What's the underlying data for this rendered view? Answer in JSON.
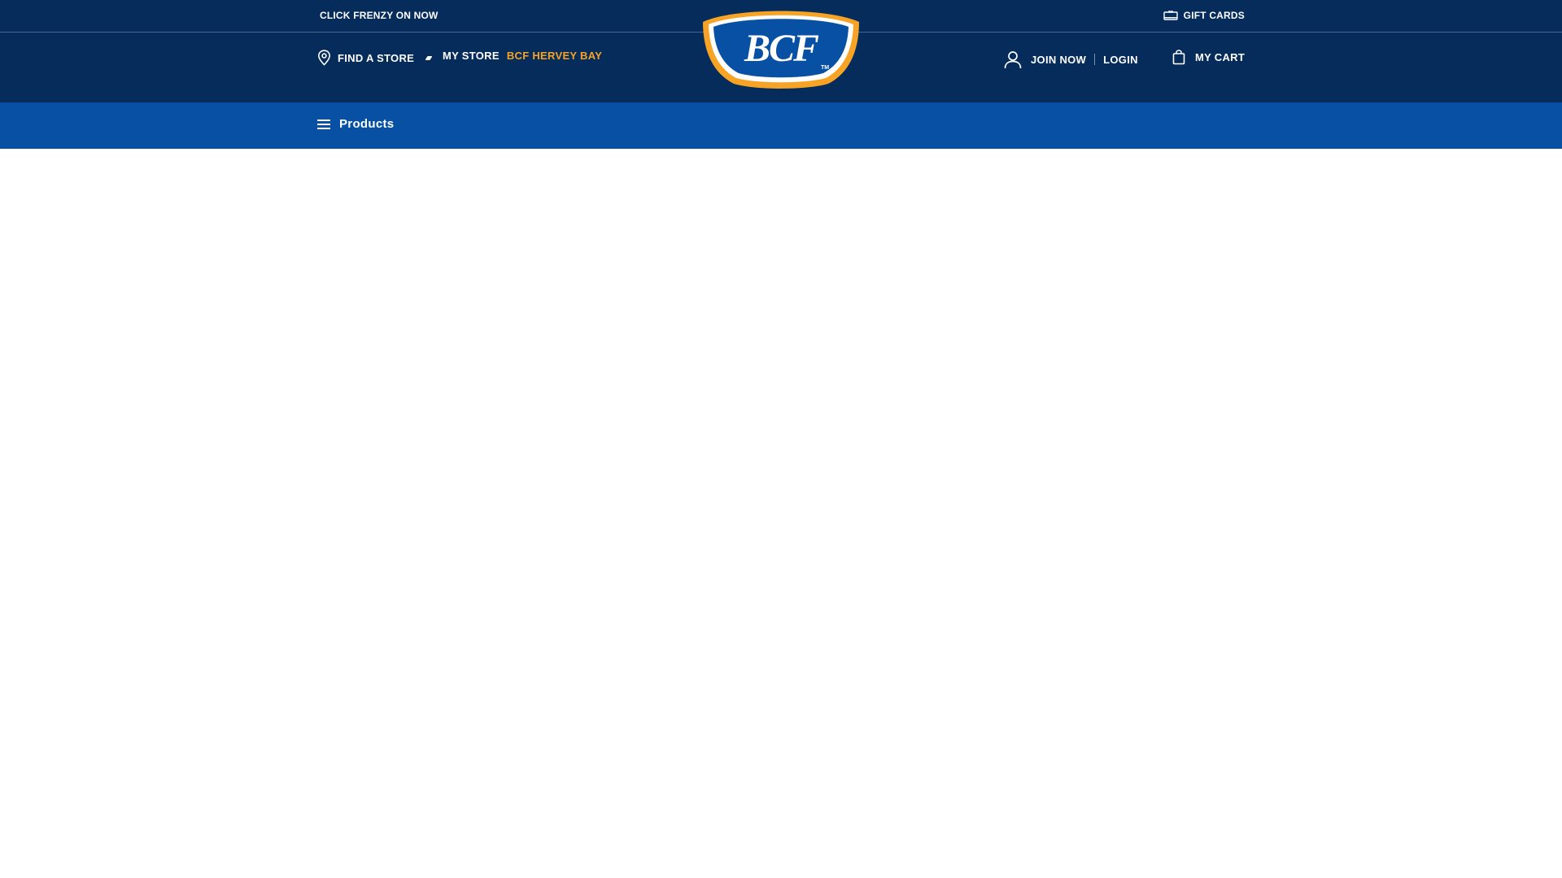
{
  "topbar": {
    "promo_text": "CLICK FRENZY ON NOW",
    "gift_cards_label": "GIFT CARDS",
    "gift_icon": "gift-card-icon"
  },
  "header": {
    "find_store_label": "FIND A STORE",
    "find_store_icon": "location-pin-icon",
    "my_store_label": "MY STORE",
    "my_store_name": "BCF HERVEY BAY",
    "join_label": "JOIN NOW",
    "login_label": "LOGIN",
    "account_icon": "user-icon",
    "cart_label": "MY CART",
    "cart_icon": "shopping-bag-icon"
  },
  "logo": {
    "text": "BCF",
    "trademark": "TM",
    "colors": {
      "outer": "#f7a325",
      "ring": "#ffffff",
      "inner": "#0850a4",
      "text": "#ffffff"
    }
  },
  "nav": {
    "products_label": "Products",
    "menu_icon": "hamburger-menu-icon"
  },
  "colors": {
    "header_bg": "#062c5c",
    "nav_bg": "#0850a4",
    "accent": "#f7a325",
    "page_bg": "#ffffff"
  }
}
